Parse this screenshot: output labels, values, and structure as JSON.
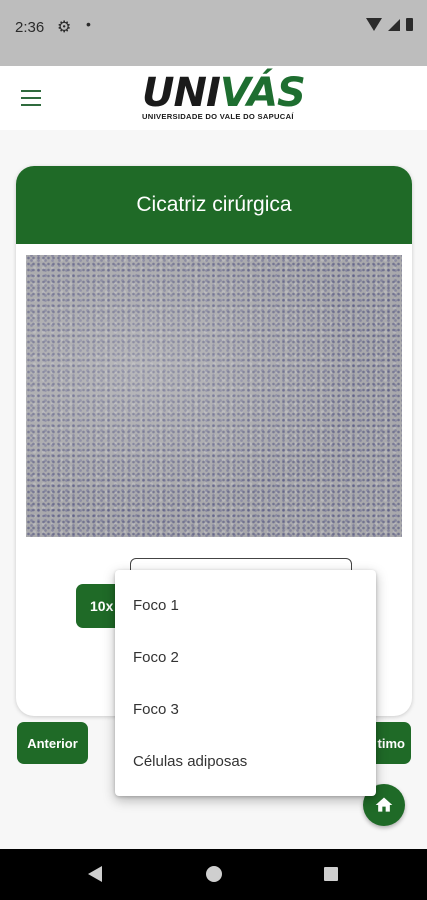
{
  "status_bar": {
    "time": "2:36",
    "icons": [
      "settings-icon",
      "dot-icon",
      "wifi-icon",
      "signal-icon",
      "battery-icon"
    ]
  },
  "header": {
    "menu_icon": "hamburger-icon",
    "logo": {
      "uni": "UNI",
      "vas": "VÁS",
      "subtitle": "UNIVERSIDADE DO VALE DO SAPUCAÍ"
    }
  },
  "card": {
    "title": "Cicatriz cirúrgica",
    "image": "microscopy-image",
    "zoom_label": "10x"
  },
  "navigation": {
    "prev_label": "Anterior",
    "next_label": "timo"
  },
  "dropdown": {
    "options": [
      "Foco 1",
      "Foco 2",
      "Foco 3",
      "Células adiposas"
    ]
  },
  "fab": {
    "icon": "home-icon"
  },
  "system_nav": {
    "icons": [
      "back-icon",
      "home-circle-icon",
      "recents-icon"
    ]
  },
  "colors": {
    "primary": "#1f6a27",
    "status_bar": "#bdbdbd",
    "background": "#f7f7f7"
  }
}
